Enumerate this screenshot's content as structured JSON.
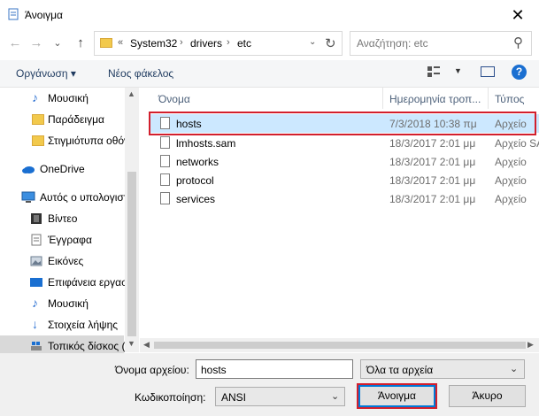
{
  "window": {
    "title": "Άνοιγμα",
    "close_glyph": "✕"
  },
  "nav": {
    "back_glyph": "←",
    "forward_glyph": "→",
    "history_glyph": "⌄",
    "up_glyph": "↑"
  },
  "address": {
    "overflow": "«",
    "crumbs": [
      "System32",
      "drivers",
      "etc"
    ],
    "separator": "›"
  },
  "search": {
    "placeholder": "Αναζήτηση: etc"
  },
  "toolbar": {
    "organize_label": "Οργάνωση ▾",
    "new_folder_label": "Νέος φάκελος",
    "help_glyph": "?"
  },
  "sidebar": {
    "items": [
      {
        "label": "Μουσική",
        "icon": "music-icon"
      },
      {
        "label": "Παράδειγμα",
        "icon": "folder-icon"
      },
      {
        "label": "Στιγμιότυπα οθόνης",
        "icon": "folder-icon"
      },
      {
        "label": "OneDrive",
        "icon": "cloud-icon"
      },
      {
        "label": "Αυτός ο υπολογιστής",
        "icon": "computer-icon"
      },
      {
        "label": "Βίντεο",
        "icon": "video-icon"
      },
      {
        "label": "Έγγραφα",
        "icon": "documents-icon"
      },
      {
        "label": "Εικόνες",
        "icon": "pictures-icon"
      },
      {
        "label": "Επιφάνεια εργασίας",
        "icon": "desktop-icon"
      },
      {
        "label": "Μουσική",
        "icon": "music-icon"
      },
      {
        "label": "Στοιχεία λήψης",
        "icon": "downloads-icon"
      },
      {
        "label": "Τοπικός δίσκος (C:)",
        "icon": "drive-icon"
      }
    ]
  },
  "columns": {
    "name": "Όνομα",
    "date": "Ημερομηνία τροπ...",
    "type": "Τύπος"
  },
  "files": [
    {
      "name": "hosts",
      "date": "7/3/2018 10:38 πμ",
      "type": "Αρχείο"
    },
    {
      "name": "lmhosts.sam",
      "date": "18/3/2017 2:01 μμ",
      "type": "Αρχείο SAM"
    },
    {
      "name": "networks",
      "date": "18/3/2017 2:01 μμ",
      "type": "Αρχείο"
    },
    {
      "name": "protocol",
      "date": "18/3/2017 2:01 μμ",
      "type": "Αρχείο"
    },
    {
      "name": "services",
      "date": "18/3/2017 2:01 μμ",
      "type": "Αρχείο"
    }
  ],
  "bottom": {
    "filename_label": "Όνομα αρχείου:",
    "filename_value": "hosts",
    "filter_value": "Όλα τα αρχεία",
    "encoding_label": "Κωδικοποίηση:",
    "encoding_value": "ANSI",
    "open_button": "Άνοιγμα",
    "cancel_button": "Άκυρο"
  },
  "colors": {
    "selection": "#cce8ff",
    "highlight_box": "#d21f2d",
    "accent": "#0078d7"
  }
}
